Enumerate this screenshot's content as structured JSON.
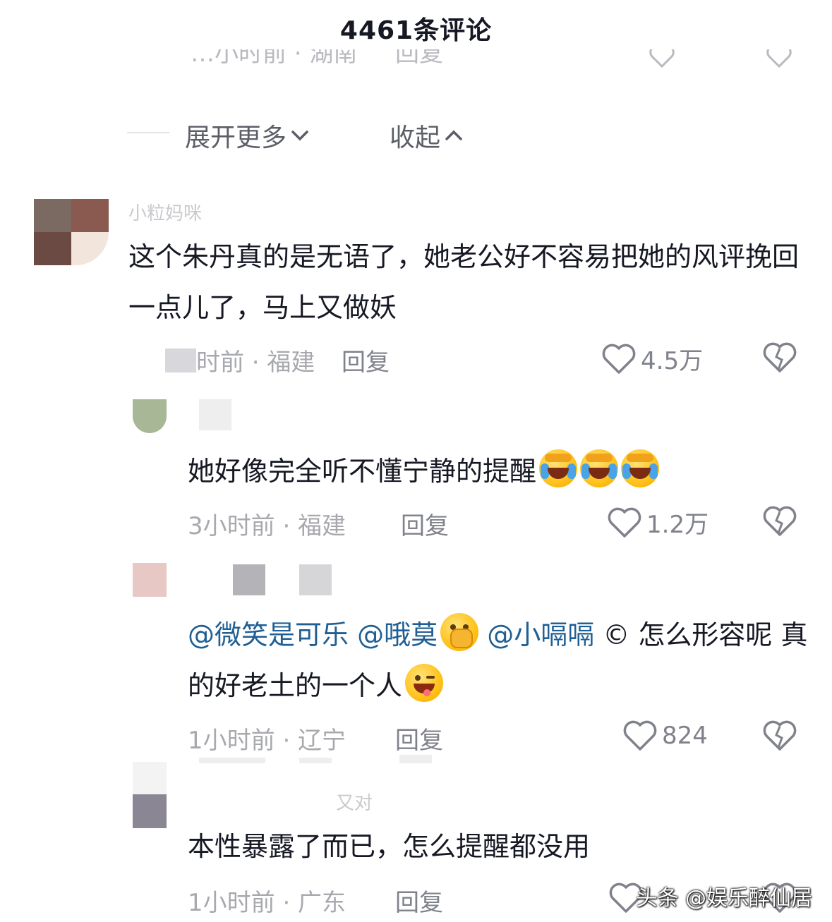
{
  "header": {
    "title": "4461条评论"
  },
  "cut_row": {
    "text_left": "…小时前 · 湖南",
    "text_reply": "回复"
  },
  "thread_controls": {
    "expand_label": "展开更多",
    "collapse_label": "收起"
  },
  "comments": [
    {
      "username": "小粒妈咪",
      "text": "这个朱丹真的是无语了，她老公好不容易把她的风评挽回一点儿了，马上又做妖",
      "meta": "时前 · 福建",
      "reply_label": "回复",
      "likes": "4.5万"
    },
    {
      "text": "她好像完全听不懂宁静的提醒",
      "emojis": [
        "laugh-cry-emoji",
        "laugh-cry-emoji",
        "laugh-cry-emoji"
      ],
      "meta": "3小时前 · 福建",
      "reply_label": "回复",
      "likes": "1.2万"
    },
    {
      "mentions": [
        "@微笑是可乐",
        "@哦莫",
        "@小嗝嗝"
      ],
      "text_rest": "© 怎么形容呢 真的好老土的一个人",
      "meta": "1小时前 · 辽宁",
      "reply_label": "回复",
      "likes": "824"
    },
    {
      "username": "又对",
      "text": "本性暴露了而已，怎么提醒都没用",
      "meta": "1小时前 · 广东",
      "reply_label": "回复"
    }
  ],
  "watermark": "头条 @娱乐醉仙居",
  "colors": {
    "mention": "#1f5f93",
    "meta": "#a8a9ae",
    "text": "#161823"
  }
}
